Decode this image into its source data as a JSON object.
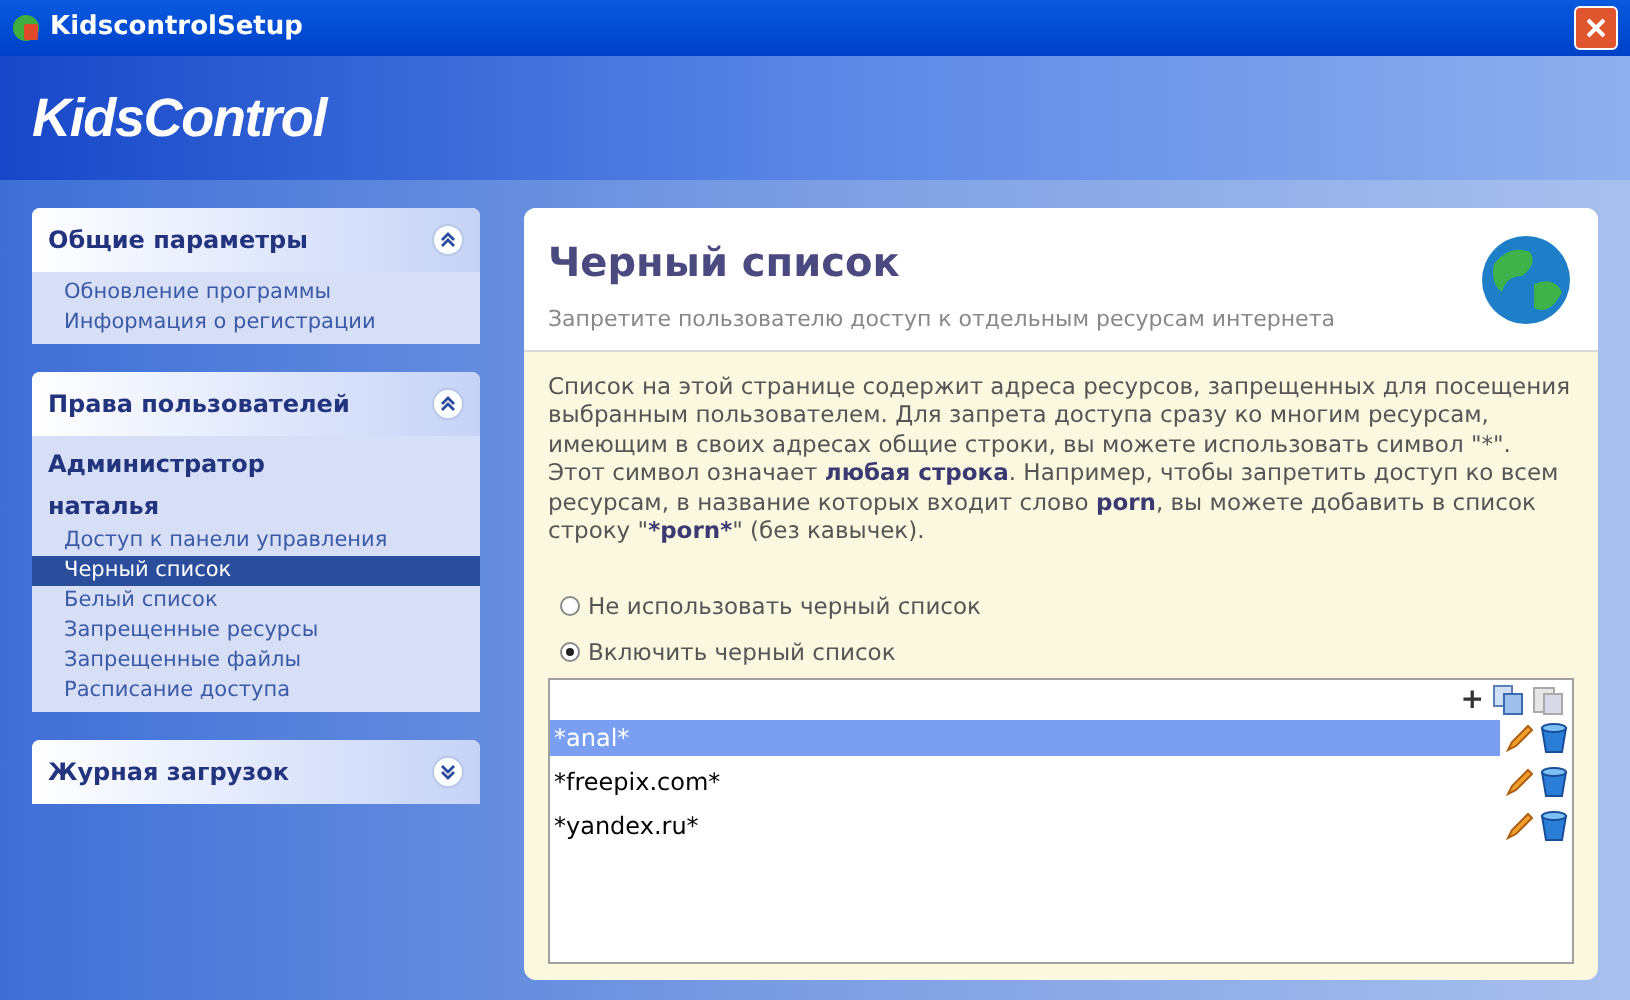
{
  "window": {
    "title": "KidscontrolSetup"
  },
  "banner": {
    "logo": "KidsControl"
  },
  "sidebar": {
    "groups": [
      {
        "title": "Общие параметры",
        "expanded": true,
        "items": [
          {
            "label": "Обновление программы",
            "kind": "link",
            "selected": false
          },
          {
            "label": "Информация о регистрации",
            "kind": "link",
            "selected": false
          }
        ]
      },
      {
        "title": "Права пользователей",
        "expanded": true,
        "items": [
          {
            "label": "Администратор",
            "kind": "user",
            "selected": false
          },
          {
            "label": "наталья",
            "kind": "user",
            "selected": false
          },
          {
            "label": "Доступ к панели управления",
            "kind": "link",
            "selected": false
          },
          {
            "label": "Черный список",
            "kind": "link",
            "selected": true
          },
          {
            "label": "Белый список",
            "kind": "link",
            "selected": false
          },
          {
            "label": "Запрещенные ресурсы",
            "kind": "link",
            "selected": false
          },
          {
            "label": "Запрещенные файлы",
            "kind": "link",
            "selected": false
          },
          {
            "label": "Расписание доступа",
            "kind": "link",
            "selected": false
          }
        ]
      },
      {
        "title": "Журная загрузок",
        "expanded": false
      }
    ]
  },
  "main": {
    "title": "Черный список",
    "subtitle": "Запретите пользователю доступ к отдельным ресурсам интернета",
    "description": [
      {
        "text": "Список на этой странице содержит адреса ресурсов, запрещенных для посещения выбранным пользователем. Для запрета доступа сразу ко многим ресурсам, имеющим в своих адресах общие строки, вы можете использовать символ \"*\". Этот символ означает ",
        "bold": false
      },
      {
        "text": "любая строка",
        "bold": true
      },
      {
        "text": ". Например, чтобы запретить доступ ко всем ресурсам, в название которых входит слово ",
        "bold": false
      },
      {
        "text": "porn",
        "bold": true
      },
      {
        "text": ", вы можете добавить в список строку \"",
        "bold": false
      },
      {
        "text": "*porn*",
        "bold": true
      },
      {
        "text": "\" (без кавычек).",
        "bold": false
      }
    ],
    "options": [
      {
        "label": "Не использовать черный список",
        "selected": false
      },
      {
        "label": "Включить черный список",
        "selected": true
      }
    ],
    "add_symbol": "+",
    "entries": [
      {
        "text": "*anal*",
        "selected": true
      },
      {
        "text": "*freepix.com*",
        "selected": false
      },
      {
        "text": "*yandex.ru*",
        "selected": false
      }
    ]
  }
}
